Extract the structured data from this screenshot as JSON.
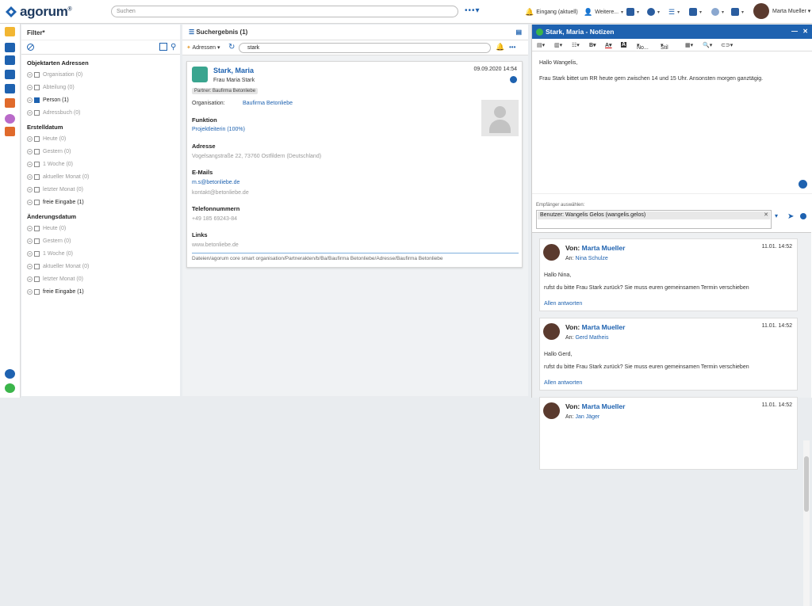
{
  "topbar": {
    "search_placeholder": "Suchen",
    "inbox": "Eingang (aktuell)",
    "more": "Weitere...",
    "user": "Marta Mueller"
  },
  "filter": {
    "title": "Filter*",
    "sections": [
      {
        "title": "Objektarten Adressen",
        "items": [
          {
            "label": "Organisation (0)",
            "active": false
          },
          {
            "label": "Abteilung (0)",
            "active": false
          },
          {
            "label": "Person (1)",
            "active": true
          },
          {
            "label": "Adressbuch (0)",
            "active": false
          }
        ]
      },
      {
        "title": "Erstelldatum",
        "items": [
          {
            "label": "Heute (0)",
            "active": false
          },
          {
            "label": "Gestern (0)",
            "active": false
          },
          {
            "label": "1 Woche (0)",
            "active": false
          },
          {
            "label": "aktueller Monat (0)",
            "active": false
          },
          {
            "label": "letzter Monat (0)",
            "active": false
          },
          {
            "label": "freie Eingabe (1)",
            "active": true
          }
        ]
      },
      {
        "title": "Änderungsdatum",
        "items": [
          {
            "label": "Heute (0)",
            "active": false
          },
          {
            "label": "Gestern (0)",
            "active": false
          },
          {
            "label": "1 Woche (0)",
            "active": false
          },
          {
            "label": "aktueller Monat (0)",
            "active": false
          },
          {
            "label": "letzter Monat (0)",
            "active": false
          },
          {
            "label": "freie Eingabe (1)",
            "active": true
          }
        ]
      }
    ]
  },
  "results": {
    "title": "Suchergebnis (1)",
    "type": "Adressen",
    "query": "stark",
    "card": {
      "name": "Stark, Maria",
      "date": "09.09.2020 14:54",
      "salutation": "Frau Maria Stark",
      "tag": "Partner: Baufirma Betonliebe",
      "org_label": "Organisation:",
      "org": "Baufirma Betonliebe",
      "funktion_h": "Funktion",
      "funktion": "Projektleiterin (100%)",
      "adresse_h": "Adresse",
      "adresse": "Vogelsangstraße 22, 73760 Ostfildern (Deutschland)",
      "emails_h": "E-Mails",
      "email1": "m.s@betonliebe.de",
      "email2": "kontakt@betonliebe.de",
      "tel_h": "Telefonnummern",
      "tel": "+49 185 69243-84",
      "links_h": "Links",
      "link": "www.betonliebe.de",
      "path": "Dateien/agorum core smart organisation/Partnerakten/b/Ba/Baufirma Betonliebe/Adresse/Baufirma Betonliebe"
    }
  },
  "notes": {
    "title": "Stark, Maria - Notizen",
    "toolbar": {
      "font": "No...",
      "style": "Stil"
    },
    "body": [
      "Hallo Wangelis,",
      "Frau Stark bittet um RR heute gern zwischen 14 und 15 Uhr. Ansonsten morgen ganztägig."
    ],
    "recipient_label": "Empfänger auswählen:",
    "recipient": "Benutzer: Wangelis Gelos (wangelis.gelos)",
    "messages": [
      {
        "from_label": "Von:",
        "from": "Marta Mueller",
        "date": "11.01. 14:52",
        "to_label": "An:",
        "to": "Nina Schulze",
        "greeting": "Hallo Nina,",
        "text": "rufst du bitte Frau Stark zurück? Sie muss euren gemeinsamen Termin verschieben",
        "reply": "Allen antworten"
      },
      {
        "from_label": "Von:",
        "from": "Marta Mueller",
        "date": "11.01. 14:52",
        "to_label": "An:",
        "to": "Gerd Matheis",
        "greeting": "Hallo Gerd,",
        "text": "rufst du bitte Frau Stark zurück? Sie muss euren gemeinsamen Termin verschieben",
        "reply": "Allen antworten"
      },
      {
        "from_label": "Von:",
        "from": "Marta Mueller",
        "date": "11.01. 14:52",
        "to_label": "An:",
        "to": "Jan Jäger"
      }
    ]
  }
}
